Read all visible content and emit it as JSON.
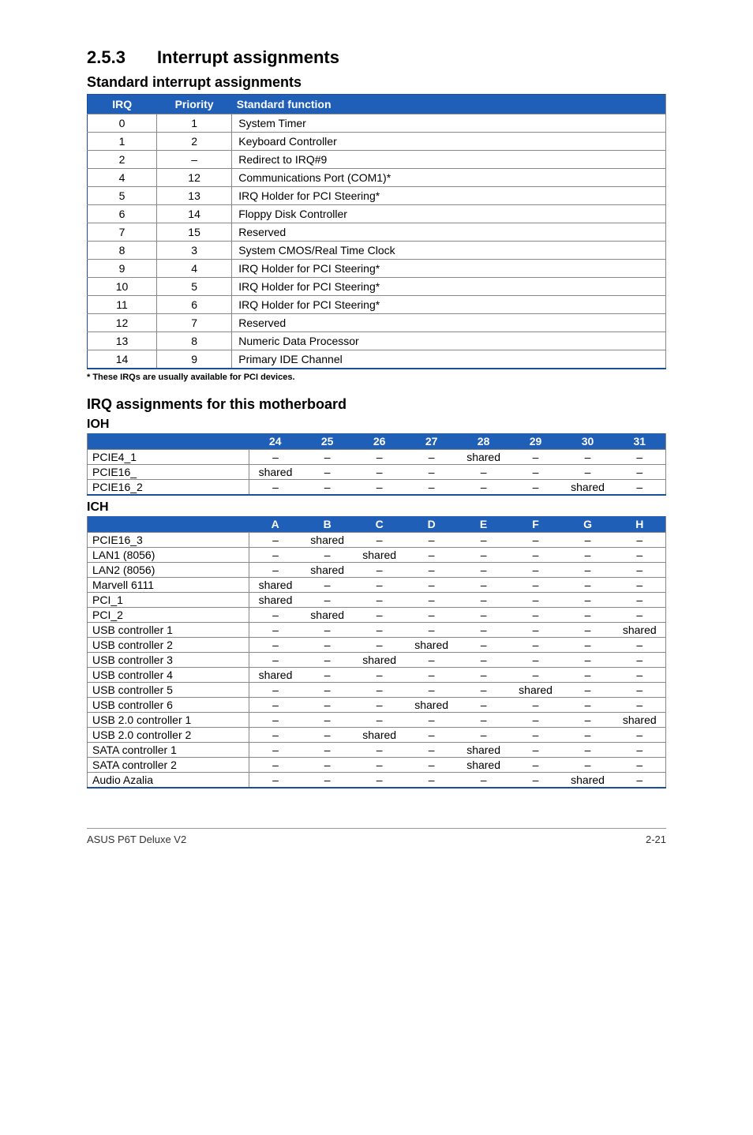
{
  "section": {
    "number": "2.5.3",
    "title": "Interrupt assignments"
  },
  "std": {
    "heading": "Standard interrupt assignments",
    "headers": {
      "irq": "IRQ",
      "priority": "Priority",
      "func": "Standard function"
    },
    "rows": [
      {
        "irq": "0",
        "prio": "1",
        "func": "System Timer"
      },
      {
        "irq": "1",
        "prio": "2",
        "func": "Keyboard Controller"
      },
      {
        "irq": "2",
        "prio": "–",
        "func": "Redirect to IRQ#9"
      },
      {
        "irq": "4",
        "prio": "12",
        "func": "Communications Port (COM1)*"
      },
      {
        "irq": "5",
        "prio": "13",
        "func": "IRQ Holder for PCI Steering*"
      },
      {
        "irq": "6",
        "prio": "14",
        "func": "Floppy Disk Controller"
      },
      {
        "irq": "7",
        "prio": "15",
        "func": "Reserved"
      },
      {
        "irq": "8",
        "prio": "3",
        "func": "System CMOS/Real Time Clock"
      },
      {
        "irq": "9",
        "prio": "4",
        "func": "IRQ Holder for PCI Steering*"
      },
      {
        "irq": "10",
        "prio": "5",
        "func": "IRQ Holder for PCI Steering*"
      },
      {
        "irq": "11",
        "prio": "6",
        "func": "IRQ Holder for PCI Steering*"
      },
      {
        "irq": "12",
        "prio": "7",
        "func": "Reserved"
      },
      {
        "irq": "13",
        "prio": "8",
        "func": "Numeric Data Processor"
      },
      {
        "irq": "14",
        "prio": "9",
        "func": "Primary IDE Channel"
      }
    ],
    "footnote": "* These IRQs are usually available for PCI devices."
  },
  "mb": {
    "heading": "IRQ assignments for this motherboard",
    "ioh": {
      "title": "IOH",
      "cols": [
        "24",
        "25",
        "26",
        "27",
        "28",
        "29",
        "30",
        "31"
      ],
      "rows": [
        {
          "label": "PCIE4_1",
          "vals": [
            "–",
            "–",
            "–",
            "–",
            "shared",
            "–",
            "–",
            "–"
          ]
        },
        {
          "label": "PCIE16_",
          "vals": [
            "shared",
            "–",
            "–",
            "–",
            "–",
            "–",
            "–",
            "–"
          ]
        },
        {
          "label": "PCIE16_2",
          "vals": [
            "–",
            "–",
            "–",
            "–",
            "–",
            "–",
            "shared",
            "–"
          ]
        }
      ]
    },
    "ich": {
      "title": "ICH",
      "cols": [
        "A",
        "B",
        "C",
        "D",
        "E",
        "F",
        "G",
        "H"
      ],
      "rows": [
        {
          "label": "PCIE16_3",
          "vals": [
            "–",
            "shared",
            "–",
            "–",
            "–",
            "–",
            "–",
            "–"
          ]
        },
        {
          "label": "LAN1 (8056)",
          "vals": [
            "–",
            "–",
            "shared",
            "–",
            "–",
            "–",
            "–",
            "–"
          ]
        },
        {
          "label": "LAN2 (8056)",
          "vals": [
            "–",
            "shared",
            "–",
            "–",
            "–",
            "–",
            "–",
            "–"
          ]
        },
        {
          "label": "Marvell 6111",
          "vals": [
            "shared",
            "–",
            "–",
            "–",
            "–",
            "–",
            "–",
            "–"
          ]
        },
        {
          "label": "PCI_1",
          "vals": [
            "shared",
            "–",
            "–",
            "–",
            "–",
            "–",
            "–",
            "–"
          ]
        },
        {
          "label": "PCI_2",
          "vals": [
            "–",
            "shared",
            "–",
            "–",
            "–",
            "–",
            "–",
            "–"
          ]
        },
        {
          "label": "USB controller 1",
          "vals": [
            "–",
            "–",
            "–",
            "–",
            "–",
            "–",
            "–",
            "shared"
          ]
        },
        {
          "label": "USB controller 2",
          "vals": [
            "–",
            "–",
            "–",
            "shared",
            "–",
            "–",
            "–",
            "–"
          ]
        },
        {
          "label": "USB controller 3",
          "vals": [
            "–",
            "–",
            "shared",
            "–",
            "–",
            "–",
            "–",
            "–"
          ]
        },
        {
          "label": "USB controller 4",
          "vals": [
            "shared",
            "–",
            "–",
            "–",
            "–",
            "–",
            "–",
            "–"
          ]
        },
        {
          "label": "USB controller 5",
          "vals": [
            "–",
            "–",
            "–",
            "–",
            "–",
            "shared",
            "–",
            "–"
          ]
        },
        {
          "label": "USB controller 6",
          "vals": [
            "–",
            "–",
            "–",
            "shared",
            "–",
            "–",
            "–",
            "–"
          ]
        },
        {
          "label": "USB 2.0 controller 1",
          "vals": [
            "–",
            "–",
            "–",
            "–",
            "–",
            "–",
            "–",
            "shared"
          ]
        },
        {
          "label": "USB 2.0 controller 2",
          "vals": [
            "–",
            "–",
            "shared",
            "–",
            "–",
            "–",
            "–",
            "–"
          ]
        },
        {
          "label": "SATA controller 1",
          "vals": [
            "–",
            "–",
            "–",
            "–",
            "shared",
            "–",
            "–",
            "–"
          ]
        },
        {
          "label": "SATA controller 2",
          "vals": [
            "–",
            "–",
            "–",
            "–",
            "shared",
            "–",
            "–",
            "–"
          ]
        },
        {
          "label": "Audio Azalia",
          "vals": [
            "–",
            "–",
            "–",
            "–",
            "–",
            "–",
            "shared",
            "–"
          ]
        }
      ]
    }
  },
  "footer": {
    "left": "ASUS P6T Deluxe V2",
    "right": "2-21"
  }
}
